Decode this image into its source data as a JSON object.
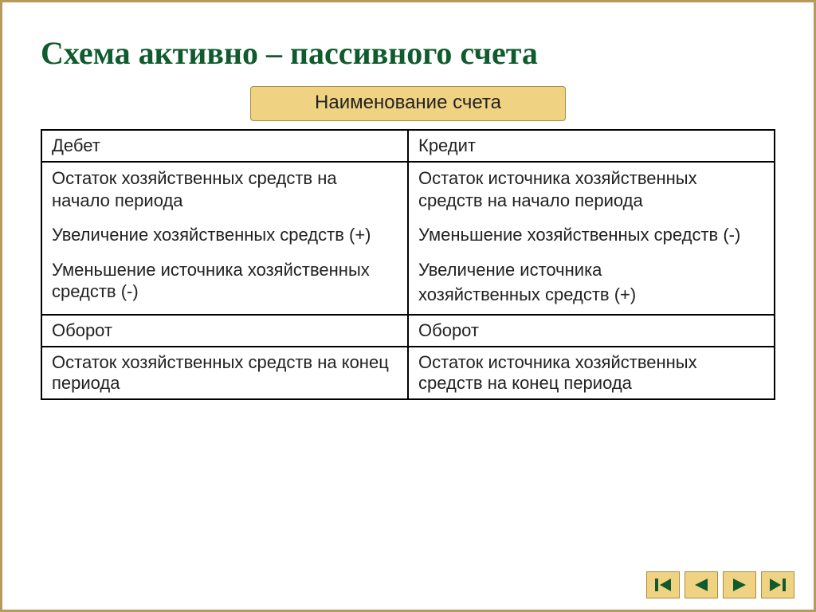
{
  "title": "Схема активно – пассивного счета",
  "badge": "Наименование счета",
  "header": {
    "debit": "Дебет",
    "credit": "Кредит"
  },
  "body": {
    "debit": {
      "line1": "Остаток  хозяйственных средств на начало периода",
      "line2": "Увеличение хозяйственных средств (+)",
      "line3": "Уменьшение источника хозяйственных средств (-)"
    },
    "credit": {
      "line1": "Остаток источника хозяйственных средств на начало периода",
      "line2": "Уменьшение хозяйственных средств (-)",
      "line3a": "Увеличение источника",
      "line3b": "хозяйственных средств (+)"
    }
  },
  "turnover": {
    "debit": "Оборот",
    "credit": "Оборот"
  },
  "end": {
    "debit": "Остаток хозяйственных средств на конец периода",
    "credit": "Остаток источника хозяйственных средств на конец периода"
  },
  "colors": {
    "title": "#0f5b2e",
    "badgeBg": "#f0d382",
    "border": "#b79a5a"
  }
}
